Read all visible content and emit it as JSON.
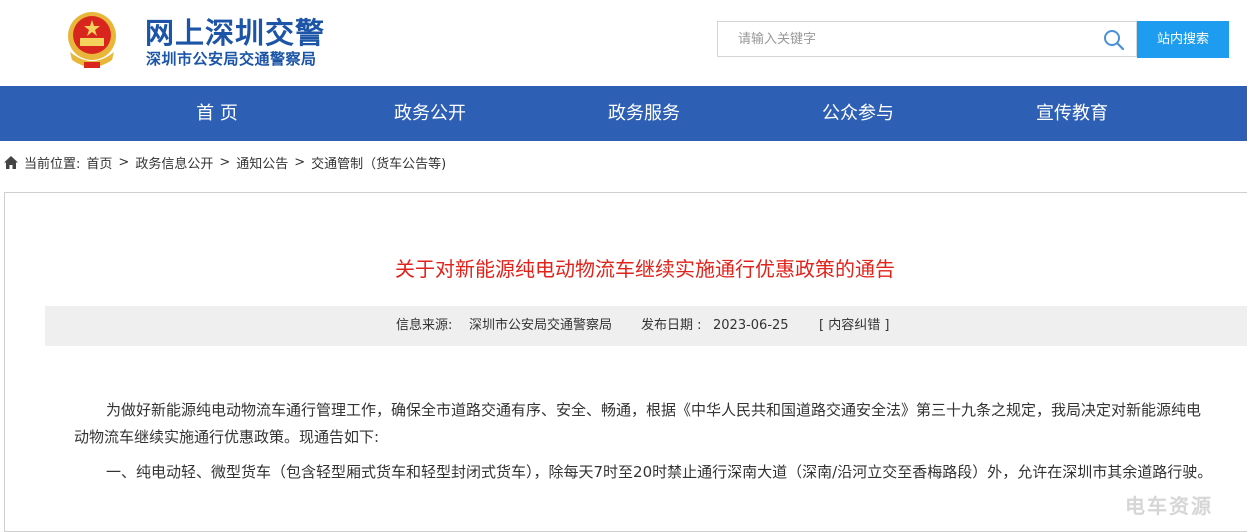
{
  "header": {
    "site_title": "网上深圳交警",
    "site_subtitle": "深圳市公安局交通警察局",
    "emblem_icon": "police-emblem-icon"
  },
  "search": {
    "placeholder": "请输入关键字",
    "button_label": "站内搜索",
    "accent_color": "#1e9cf0"
  },
  "nav": {
    "background": "#2d5fb5",
    "items": [
      {
        "label": "首  页"
      },
      {
        "label": "政务公开"
      },
      {
        "label": "政务服务"
      },
      {
        "label": "公众参与"
      },
      {
        "label": "宣传教育"
      }
    ]
  },
  "breadcrumb": {
    "prefix": "当前位置:",
    "items": [
      "首页",
      "政务信息公开",
      "通知公告",
      "交通管制（货车公告等)"
    ],
    "separator": ">"
  },
  "article": {
    "title": "关于对新能源纯电动物流车继续实施通行优惠政策的通告",
    "title_color": "#e0231b",
    "meta": {
      "source_label": "信息来源:",
      "source": "深圳市公安局交通警察局",
      "date_label": "发布日期 :",
      "date": "2023-06-25",
      "correction": "[ 内容纠错 ]"
    },
    "paragraphs": [
      "为做好新能源纯电动物流车通行管理工作，确保全市道路交通有序、安全、畅通，根据《中华人民共和国道路交通安全法》第三十九条之规定，我局决定对新能源纯电动物流车继续实施通行优惠政策。现通告如下:",
      "一、纯电动轻、微型货车（包含轻型厢式货车和轻型封闭式货车），除每天7时至20时禁止通行深南大道（深南/沿河立交至香梅路段）外，允许在深圳市其余道路行驶。"
    ]
  },
  "watermark": "电车资源"
}
